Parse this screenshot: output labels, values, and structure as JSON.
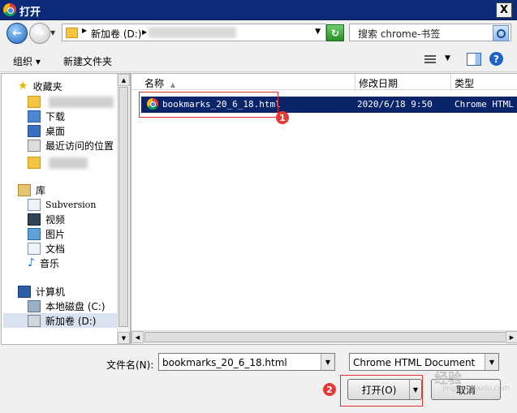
{
  "window": {
    "title": "打开",
    "close_glyph": "X"
  },
  "nav": {
    "address_folder": "新加卷 (D:)",
    "search_placeholder": "搜索 chrome-书签"
  },
  "toolbar": {
    "organize": "组织 ▾",
    "new_folder": "新建文件夹"
  },
  "sidebar": {
    "favorites": "收藏夹",
    "download": "下载",
    "desktop": "桌面",
    "recent": "最近访问的位置",
    "libraries": "库",
    "subversion": "Subversion",
    "videos": "视频",
    "pictures": "图片",
    "documents": "文档",
    "music": "音乐",
    "computer": "计算机",
    "local_disk": "本地磁盘 (C:)",
    "new_volume": "新加卷 (D:)"
  },
  "columns": {
    "name": "名称",
    "modified": "修改日期",
    "type": "类型"
  },
  "files": [
    {
      "name": "bookmarks_20_6_18.html",
      "modified": "2020/6/18 9:50",
      "type": "Chrome HTML Document"
    }
  ],
  "annotations": {
    "badge1": "1",
    "badge2": "2"
  },
  "bottom": {
    "filename_label": "文件名(N):",
    "filename_value": "bookmarks_20_6_18.html",
    "filetype_value": "Chrome HTML Document",
    "open_button": "打开(O)",
    "cancel_button": "取消"
  },
  "watermark": {
    "main": "经验",
    "sub": "jingyan.baidu.com"
  },
  "colors": {
    "title_bar": "#0b2a78",
    "selection": "#0a246a",
    "annotation_red": "#e53935"
  }
}
